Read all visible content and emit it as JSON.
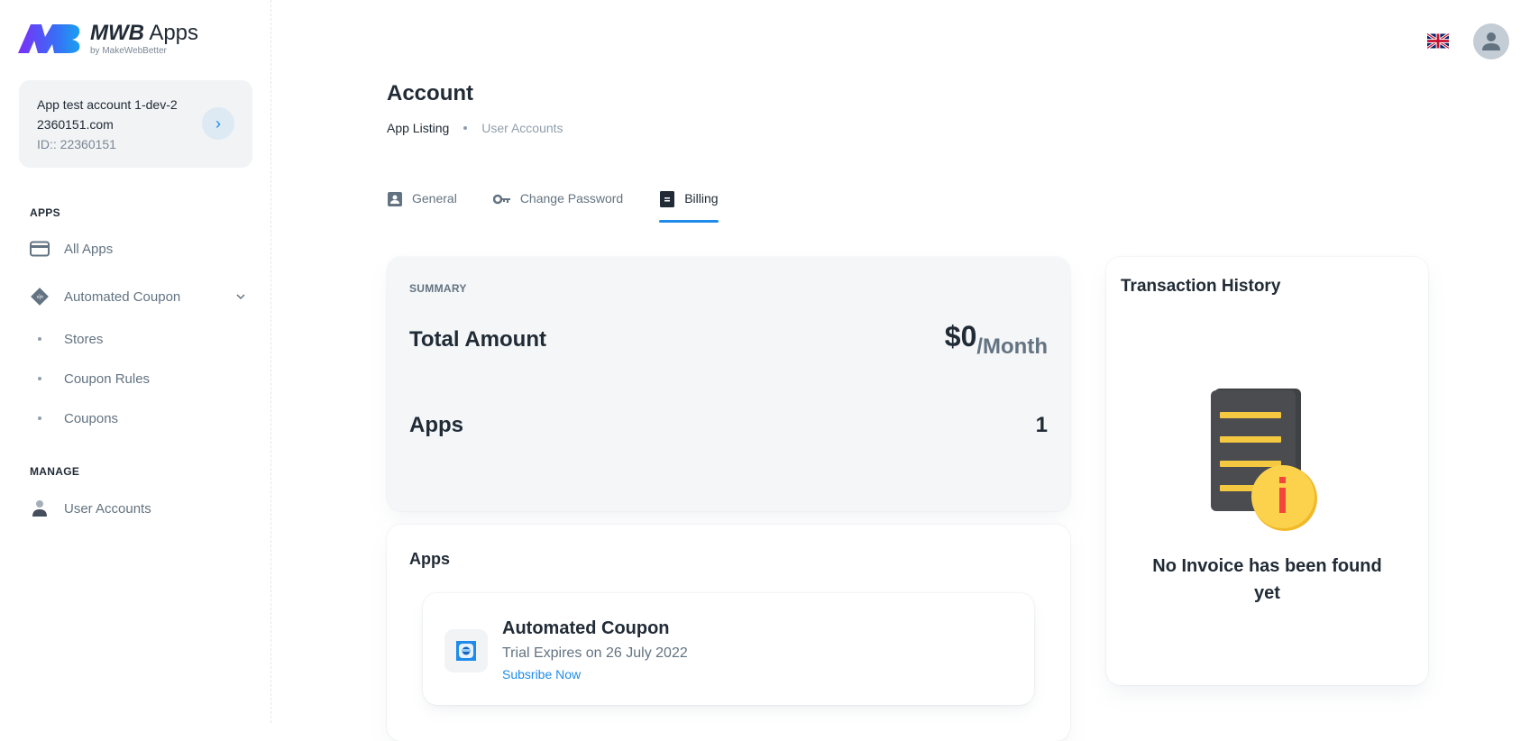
{
  "brand": {
    "title_bold": "MWB",
    "title_rest": " Apps",
    "subtitle": "by MakeWebBetter"
  },
  "account": {
    "name": "App test account 1-dev-2 2360151.com",
    "id": "ID:: 22360151",
    "open_icon": "chevron-right-icon"
  },
  "sidebar": {
    "sections": [
      {
        "label": "APPS"
      },
      {
        "label": "MANAGE"
      }
    ],
    "items": [
      {
        "label": "All Apps",
        "icon": "credit-card-icon"
      },
      {
        "label": "Automated Coupon",
        "icon": "coupon-tag-icon",
        "expanded": true
      },
      {
        "label": "Stores",
        "icon": "bullet"
      },
      {
        "label": "Coupon Rules",
        "icon": "bullet"
      },
      {
        "label": "Coupons",
        "icon": "bullet"
      },
      {
        "label": "User Accounts",
        "icon": "user-icon"
      }
    ]
  },
  "topbar": {
    "language": "English (UK)",
    "avatar": "user-avatar"
  },
  "page": {
    "title": "Account",
    "breadcrumb": [
      {
        "label": "App Listing"
      },
      {
        "label": "User Accounts"
      }
    ]
  },
  "tabs": [
    {
      "label": "General",
      "icon": "contact-card-icon",
      "active": false
    },
    {
      "label": "Change Password",
      "icon": "key-icon",
      "active": false
    },
    {
      "label": "Billing",
      "icon": "receipt-icon",
      "active": true
    }
  ],
  "summary": {
    "label": "SUMMARY",
    "total_label": "Total Amount",
    "amount": "$0",
    "period": "/Month",
    "apps_label": "Apps",
    "apps_count": "1"
  },
  "apps": {
    "title": "Apps",
    "items": [
      {
        "name": "Automated Coupon",
        "trial": "Trial Expires on 26 July 2022",
        "action": "Subsribe Now"
      }
    ]
  },
  "transactions": {
    "title": "Transaction History",
    "empty_message": "No Invoice has been found yet"
  },
  "colors": {
    "accent": "#1f8bea",
    "text": "#212b36",
    "muted": "#637381",
    "card_bg": "#f4f6f8"
  }
}
